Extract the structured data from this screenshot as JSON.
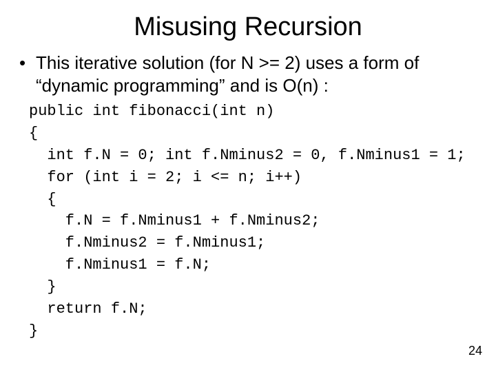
{
  "title": "Misusing Recursion",
  "bullet_text": "This iterative solution (for N >= 2) uses a form of “dynamic programming” and is O(n) :",
  "code": {
    "l1": "public int fibonacci(int n)",
    "l2": "{",
    "l3": "  int f.N = 0; int f.Nminus2 = 0, f.Nminus1 = 1;",
    "l4": "  for (int i = 2; i <= n; i++)",
    "l5": "  {",
    "l6": "    f.N = f.Nminus1 + f.Nminus2;",
    "l7": "    f.Nminus2 = f.Nminus1;",
    "l8": "    f.Nminus1 = f.N;",
    "l9": "  }",
    "l10": "  return f.N;",
    "l11": "}"
  },
  "page_number": "24"
}
